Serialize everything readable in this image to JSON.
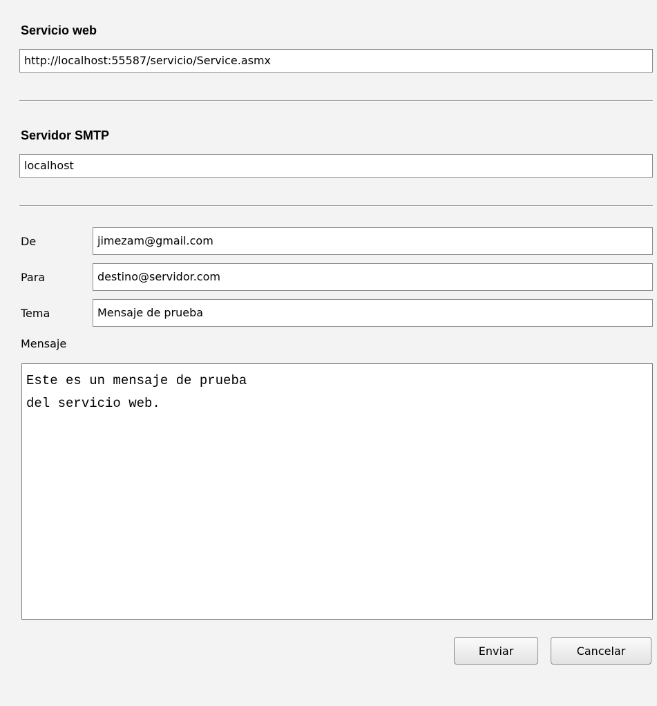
{
  "servicio_web": {
    "heading": "Servicio web",
    "url_value": "http://localhost:55587/servicio/Service.asmx"
  },
  "servidor_smtp": {
    "heading": "Servidor SMTP",
    "host_value": "localhost"
  },
  "form": {
    "de_label": "De",
    "de_value": "jimezam@gmail.com",
    "para_label": "Para",
    "para_value": "destino@servidor.com",
    "tema_label": "Tema",
    "tema_value": "Mensaje de prueba",
    "mensaje_label": "Mensaje",
    "mensaje_value": "Este es un mensaje de prueba\ndel servicio web."
  },
  "actions": {
    "enviar_label": "Enviar",
    "cancelar_label": "Cancelar"
  }
}
